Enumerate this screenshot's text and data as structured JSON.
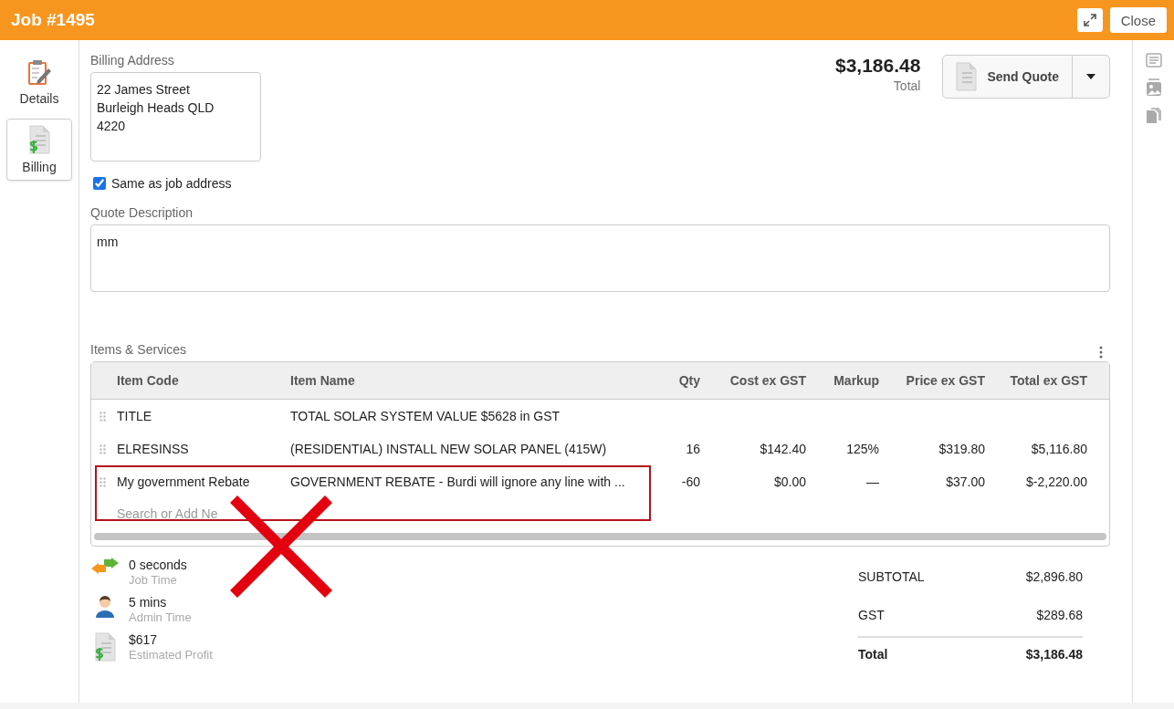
{
  "window": {
    "title": "Job #1495",
    "close_label": "Close"
  },
  "sidebar": {
    "items": [
      {
        "kind": "details",
        "label": "Details",
        "selected": false
      },
      {
        "kind": "billing",
        "label": "Billing",
        "selected": true
      }
    ]
  },
  "billing_address": {
    "label": "Billing Address",
    "value": "22 James Street\nBurleigh Heads QLD\n4220"
  },
  "same_as_job_address": {
    "label": "Same as job address",
    "checked": true
  },
  "summary": {
    "amount": "$3,186.48",
    "label": "Total"
  },
  "send_quote": {
    "label": "Send Quote"
  },
  "quote_description": {
    "label": "Quote Description",
    "value": "mm"
  },
  "items": {
    "label": "Items & Services",
    "columns": [
      "Item Code",
      "Item Name",
      "Qty",
      "Cost ex GST",
      "Markup",
      "Price ex GST",
      "Total ex GST"
    ],
    "rows": [
      {
        "code": "TITLE",
        "name": "TOTAL SOLAR SYSTEM VALUE $5628 in GST",
        "qty": "",
        "cost": "",
        "markup": "",
        "price": "",
        "total": ""
      },
      {
        "code": "ELRESINSS",
        "name": "(RESIDENTIAL) INSTALL NEW SOLAR PANEL (415W)",
        "qty": "16",
        "cost": "$142.40",
        "markup": "125%",
        "price": "$319.80",
        "total": "$5,116.80"
      },
      {
        "code": "My government Rebate",
        "name": "GOVERNMENT REBATE - Burdi will ignore any line with ...",
        "qty": "-60",
        "cost": "$0.00",
        "markup": "—",
        "price": "$37.00",
        "total": "$-2,220.00"
      }
    ],
    "search": {
      "placeholder": "Search or Add Ne"
    }
  },
  "stats": [
    {
      "kind": "job_time",
      "value": "0 seconds",
      "label": "Job Time"
    },
    {
      "kind": "admin_time",
      "value": "5 mins",
      "label": "Admin Time"
    },
    {
      "kind": "profit",
      "value": "$617",
      "label": "Estimated Profit"
    }
  ],
  "totals": [
    {
      "kind": "line",
      "label": "SUBTOTAL",
      "value": "$2,896.80"
    },
    {
      "kind": "line",
      "label": "GST",
      "value": "$289.68"
    },
    {
      "kind": "grand",
      "label": "Total",
      "value": "$3,186.48"
    }
  ]
}
